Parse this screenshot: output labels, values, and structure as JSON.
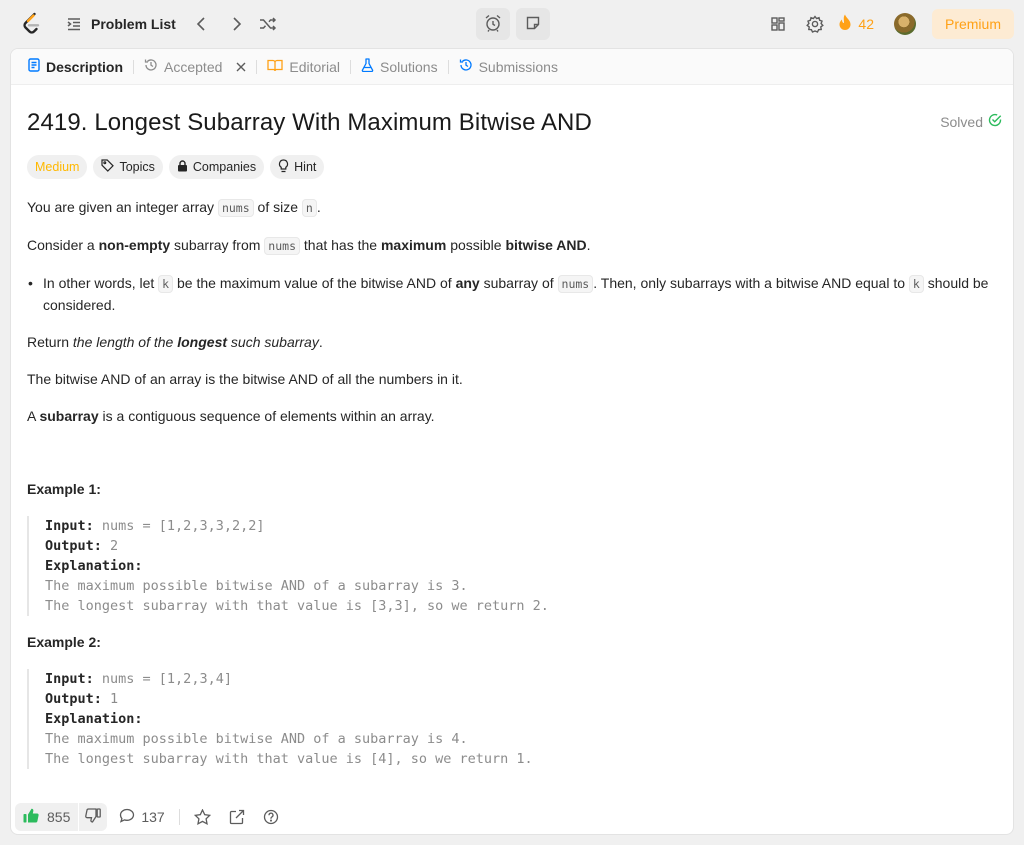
{
  "nav": {
    "problem_list_label": "Problem List",
    "streak_count": "42",
    "premium_label": "Premium"
  },
  "tabs": [
    {
      "label": "Description"
    },
    {
      "label": "Accepted"
    },
    {
      "label": "Editorial"
    },
    {
      "label": "Solutions"
    },
    {
      "label": "Submissions"
    }
  ],
  "problem": {
    "title": "2419. Longest Subarray With Maximum Bitwise AND",
    "status": "Solved",
    "tags": [
      "Medium",
      "Topics",
      "Companies",
      "Hint"
    ],
    "p1": {
      "a": "You are given an integer array ",
      "code1": "nums",
      "b": " of size ",
      "code2": "n",
      "c": "."
    },
    "p2": {
      "a": "Consider a ",
      "b1": "non-empty",
      "c": " subarray from ",
      "code": "nums",
      "d": " that has the ",
      "b2": "maximum",
      "e": " possible ",
      "b3": "bitwise AND",
      "f": "."
    },
    "bullet": {
      "a": "In other words, let ",
      "code1": "k",
      "b": " be the maximum value of the bitwise AND of ",
      "b1": "any",
      "c": " subarray of ",
      "code2": "nums",
      "d": ". Then, only subarrays with a bitwise AND equal to ",
      "code3": "k",
      "e": " should be considered."
    },
    "p3": {
      "a": "Return ",
      "i1": "the length of the ",
      "bi": "longest",
      "i2": " such subarray",
      "b": "."
    },
    "p4": "The bitwise AND of an array is the bitwise AND of all the numbers in it.",
    "p5": {
      "a": "A ",
      "b": "subarray",
      "c": " is a contiguous sequence of elements within an array."
    },
    "examples": [
      {
        "title": "Example 1:",
        "input_label": "Input:",
        "input": " nums = [1,2,3,3,2,2]",
        "output_label": "Output:",
        "output": " 2",
        "explanation_label": "Explanation:",
        "lines": [
          "The maximum possible bitwise AND of a subarray is 3.",
          "The longest subarray with that value is [3,3], so we return 2."
        ]
      },
      {
        "title": "Example 2:",
        "input_label": "Input:",
        "input": " nums = [1,2,3,4]",
        "output_label": "Output:",
        "output": " 1",
        "explanation_label": "Explanation:",
        "lines": [
          "The maximum possible bitwise AND of a subarray is 4.",
          "The longest subarray with that value is [4], so we return 1."
        ]
      }
    ]
  },
  "footer": {
    "likes": "855",
    "comments": "137"
  },
  "colors": {
    "accent": "#ffa116",
    "medium": "#ffb800",
    "solved_green": "#2cbb5d",
    "like_green": "#2cbb5d"
  }
}
